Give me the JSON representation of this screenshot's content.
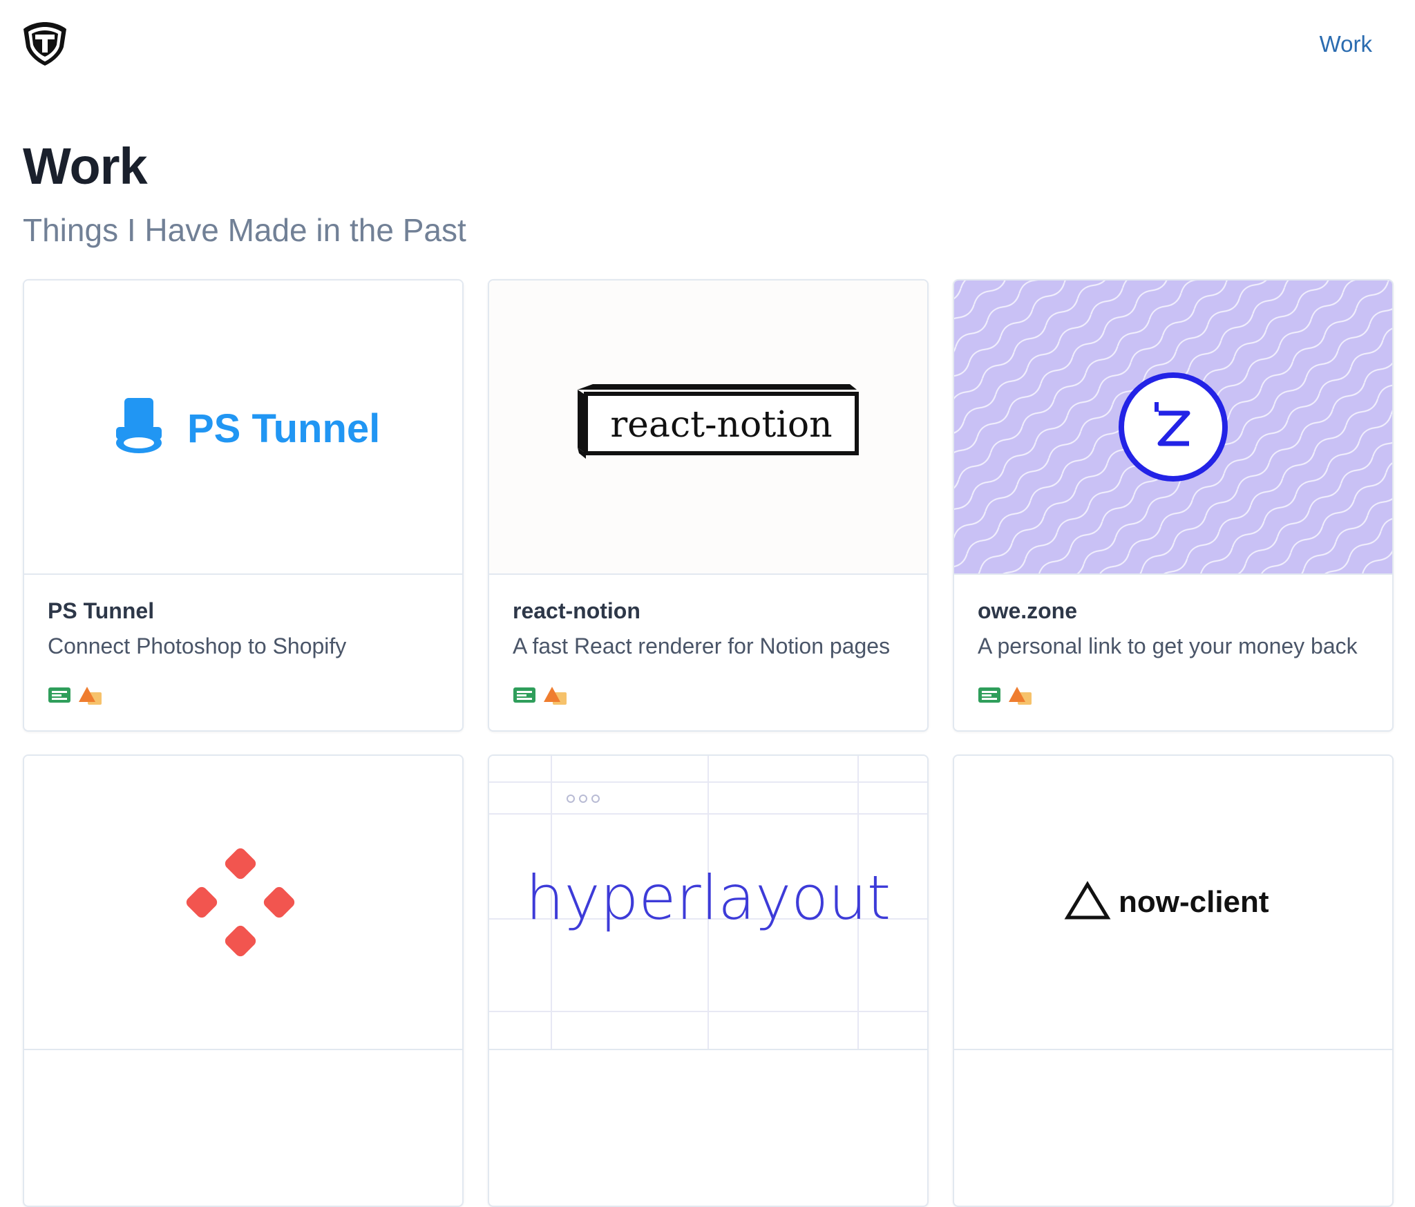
{
  "header": {
    "logo_icon": "shield-t-logo-icon",
    "nav_work": "Work"
  },
  "page": {
    "title": "Work",
    "subtitle": "Things I Have Made in the Past"
  },
  "cards": [
    {
      "image_label": "PS Tunnel",
      "image_icon": "top-hat-icon",
      "image_color": "#2196f3",
      "title": "PS Tunnel",
      "description": "Connect Photoshop to Shopify",
      "tech_icons": [
        "google-sheets-icon",
        "shapes-icon"
      ]
    },
    {
      "image_label": "react-notion",
      "image_icon": "",
      "title": "react-notion",
      "description": "A fast React renderer for Notion pages",
      "tech_icons": [
        "google-sheets-icon",
        "shapes-icon"
      ]
    },
    {
      "image_label": "",
      "image_icon": "owe-zone-z-logo-icon",
      "image_color": "#2323e6",
      "image_bg": "#c9c1f5",
      "title": "owe.zone",
      "description": "A personal link to get your money back",
      "tech_icons": [
        "google-sheets-icon",
        "shapes-icon"
      ]
    },
    {
      "image_label": "",
      "image_icon": "four-diamonds-logo-icon",
      "image_color": "#f2554f",
      "title": "",
      "description": "",
      "tech_icons": []
    },
    {
      "image_label": "hyperlayout",
      "image_icon": "",
      "image_color": "#3d3bd8",
      "title": "",
      "description": "",
      "tech_icons": []
    },
    {
      "image_label": "now-client",
      "image_icon": "triangle-logo-icon",
      "image_color": "#111111",
      "title": "",
      "description": "",
      "tech_icons": []
    }
  ],
  "colors": {
    "link": "#2b6cb0",
    "title": "#1a202c",
    "subtitle": "#718096",
    "card_border": "#e2e8f0"
  }
}
